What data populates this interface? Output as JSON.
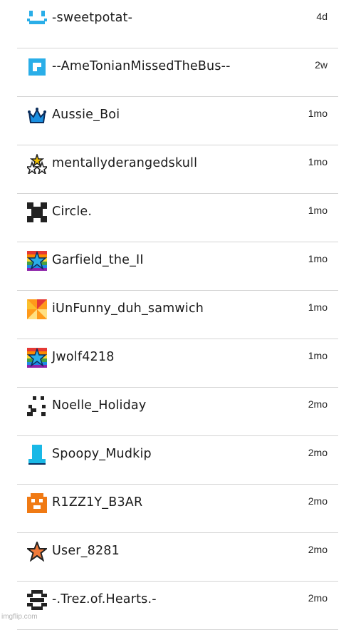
{
  "users": [
    {
      "name": "-sweetpotat-",
      "time": "4d",
      "icon": "smiley-icon",
      "color": "#2aaee8"
    },
    {
      "name": "--AmeTonianMissedTheBus--",
      "time": "2w",
      "icon": "square-block-icon",
      "color": "#2aaee8"
    },
    {
      "name": "Aussie_Boi",
      "time": "1mo",
      "icon": "crown-icon",
      "color": "#1a8fe0"
    },
    {
      "name": "mentallyderangedskull",
      "time": "1mo",
      "icon": "three-stars-icon",
      "color": "#f2c200"
    },
    {
      "name": "Circle.",
      "time": "1mo",
      "icon": "pixel-x-icon",
      "color": "#222222"
    },
    {
      "name": "Garfield_the_II",
      "time": "1mo",
      "icon": "rainbow-star-icon",
      "color": "#2aaee8"
    },
    {
      "name": "iUnFunny_duh_samwich",
      "time": "1mo",
      "icon": "pinwheel-icon",
      "color": "#ff9a1a"
    },
    {
      "name": "Jwolf4218",
      "time": "1mo",
      "icon": "rainbow-star-icon",
      "color": "#2aaee8"
    },
    {
      "name": "Noelle_Holiday",
      "time": "2mo",
      "icon": "pixel-face-icon",
      "color": "#222222"
    },
    {
      "name": "Spoopy_Mudkip",
      "time": "2mo",
      "icon": "boot-icon",
      "color": "#19b8e6"
    },
    {
      "name": "R1ZZ1Y_B3AR",
      "time": "2mo",
      "icon": "pixel-bear-icon",
      "color": "#f07a14"
    },
    {
      "name": "User_8281",
      "time": "2mo",
      "icon": "orange-star-icon",
      "color": "#f07a3a"
    },
    {
      "name": "-.Trez.of.Hearts.-",
      "time": "2mo",
      "icon": "pixel-heart-icon",
      "color": "#222222"
    }
  ],
  "footer": {
    "watermark": "imgflip.com"
  }
}
